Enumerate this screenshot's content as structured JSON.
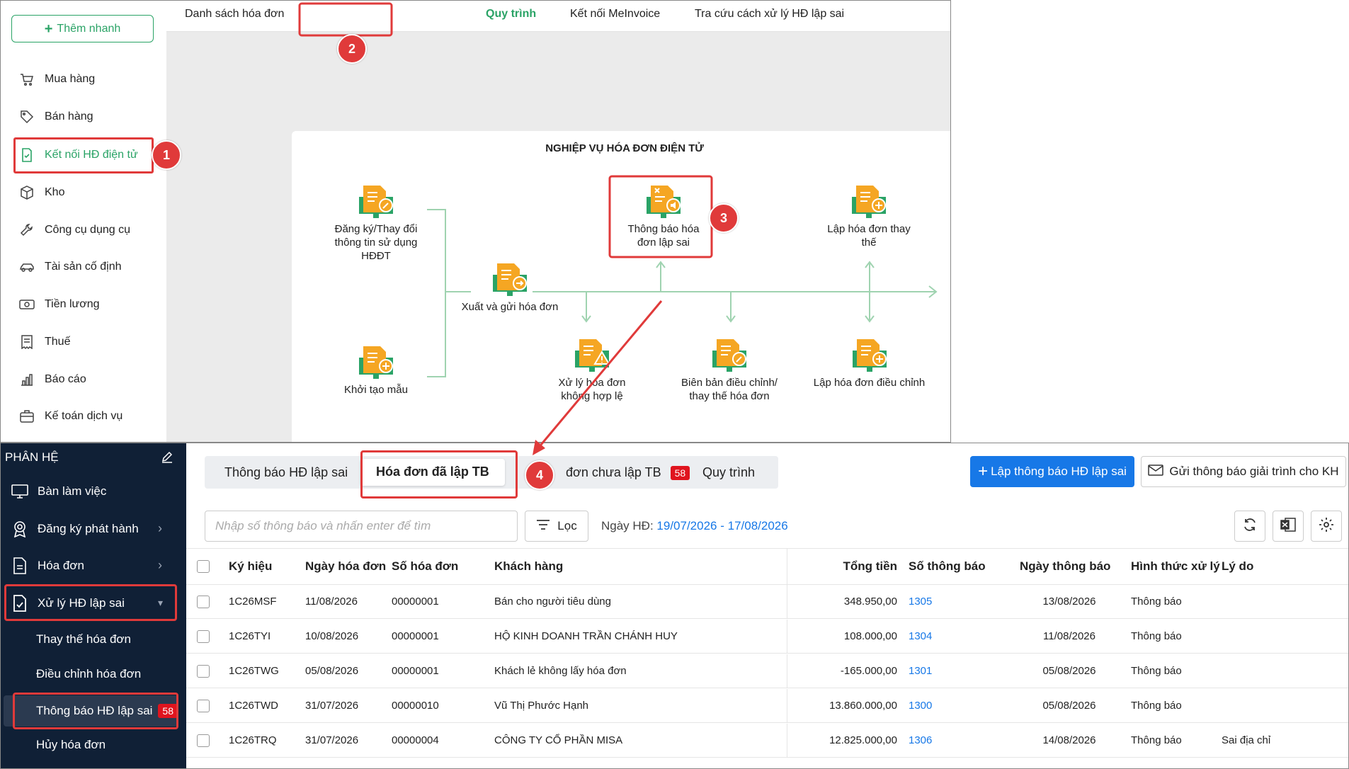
{
  "top": {
    "quick_add": "Thêm nhanh",
    "nav": [
      {
        "label": "Mua hàng",
        "icon": "cart-icon"
      },
      {
        "label": "Bán hàng",
        "icon": "tag-icon"
      },
      {
        "label": "Kết nối HĐ điện tử",
        "icon": "invoice-check-icon"
      },
      {
        "label": "Kho",
        "icon": "box-icon"
      },
      {
        "label": "Công cụ dụng cụ",
        "icon": "wrench-icon"
      },
      {
        "label": "Tài sản cố định",
        "icon": "car-icon"
      },
      {
        "label": "Tiền lương",
        "icon": "money-icon"
      },
      {
        "label": "Thuế",
        "icon": "receipt-icon"
      },
      {
        "label": "Báo cáo",
        "icon": "bar-chart-icon"
      },
      {
        "label": "Kế toán dịch vụ",
        "icon": "briefcase-icon"
      }
    ],
    "tabs": [
      "Danh sách hóa đơn",
      "Quy trình",
      "Kết nối MeInvoice",
      "Tra cứu cách xử lý HĐ lập sai"
    ],
    "process_title": "NGHIỆP VỤ HÓA ĐƠN ĐIỆN TỬ",
    "nodes": {
      "register": "Đăng ký/Thay đổi thông tin sử dụng HĐĐT",
      "template": "Khởi tạo mẫu",
      "issue": "Xuất và gửi hóa đơn",
      "notify_wrong": "Thông báo hóa đơn lập sai",
      "invalid": "Xử lý hóa đơn không hợp lệ",
      "minutes": "Biên bản điều chỉnh/ thay thế hóa đơn",
      "replace": "Lập hóa đơn thay thế",
      "adjust": "Lập hóa đơn điều chỉnh"
    }
  },
  "bottom": {
    "module_title": "PHÂN HỆ",
    "nav": [
      {
        "label": "Bàn làm việc",
        "icon": "monitor-icon"
      },
      {
        "label": "Đăng ký phát hành",
        "icon": "award-icon"
      },
      {
        "label": "Hóa đơn",
        "icon": "document-icon"
      },
      {
        "label": "Xử lý HĐ lập sai",
        "icon": "document-check-icon"
      }
    ],
    "subnav": [
      "Thay thế hóa đơn",
      "Điều chỉnh hóa đơn",
      "Thông báo HĐ lập sai",
      "Hủy hóa đơn"
    ],
    "subnav_badge": "58",
    "tabs": [
      "Thông báo HĐ lập sai",
      "Hóa đơn đã lập TB",
      "đơn chưa lập TB",
      "Quy trình"
    ],
    "tab_badge": "58",
    "create_btn": "Lập thông báo HĐ lập sai",
    "send_btn": "Gửi thông báo giải trình cho KH",
    "search_placeholder": "Nhập số thông báo và nhấn enter để tìm",
    "filter_label": "Lọc",
    "date_label": "Ngày HĐ:",
    "date_value": "19/07/2026 - 17/08/2026",
    "columns": [
      "Ký hiệu",
      "Ngày hóa đơn",
      "Số hóa đơn",
      "Khách hàng",
      "Tổng tiền",
      "Số thông báo",
      "Ngày thông báo",
      "Hình thức xử lý",
      "Lý do"
    ],
    "rows": [
      {
        "symbol": "1C26MSF",
        "date": "11/08/2026",
        "number": "00000001",
        "customer": "Bán cho người tiêu dùng",
        "total": "348.950,00",
        "notice_no": "1305",
        "notice_date": "13/08/2026",
        "method": "Thông báo",
        "reason": ""
      },
      {
        "symbol": "1C26TYI",
        "date": "10/08/2026",
        "number": "00000001",
        "customer": "HỘ KINH DOANH TRẦN CHÁNH HUY",
        "total": "108.000,00",
        "notice_no": "1304",
        "notice_date": "11/08/2026",
        "method": "Thông báo",
        "reason": ""
      },
      {
        "symbol": "1C26TWG",
        "date": "05/08/2026",
        "number": "00000001",
        "customer": "Khách lẻ không lấy hóa đơn",
        "total": "-165.000,00",
        "notice_no": "1301",
        "notice_date": "05/08/2026",
        "method": "Thông báo",
        "reason": ""
      },
      {
        "symbol": "1C26TWD",
        "date": "31/07/2026",
        "number": "00000010",
        "customer": "Vũ Thị Phước Hạnh",
        "total": "13.860.000,00",
        "notice_no": "1300",
        "notice_date": "05/08/2026",
        "method": "Thông báo",
        "reason": ""
      },
      {
        "symbol": "1C26TRQ",
        "date": "31/07/2026",
        "number": "00000004",
        "customer": "CÔNG TY CỔ PHẦN MISA",
        "total": "12.825.000,00",
        "notice_no": "1306",
        "notice_date": "14/08/2026",
        "method": "Thông báo",
        "reason": "Sai địa chỉ"
      }
    ]
  },
  "annotations": [
    "1",
    "2",
    "3",
    "4"
  ],
  "colors": {
    "green": "#2aa366",
    "blue": "#1778e7",
    "red": "#e03a3a",
    "sidebar": "#102036"
  }
}
